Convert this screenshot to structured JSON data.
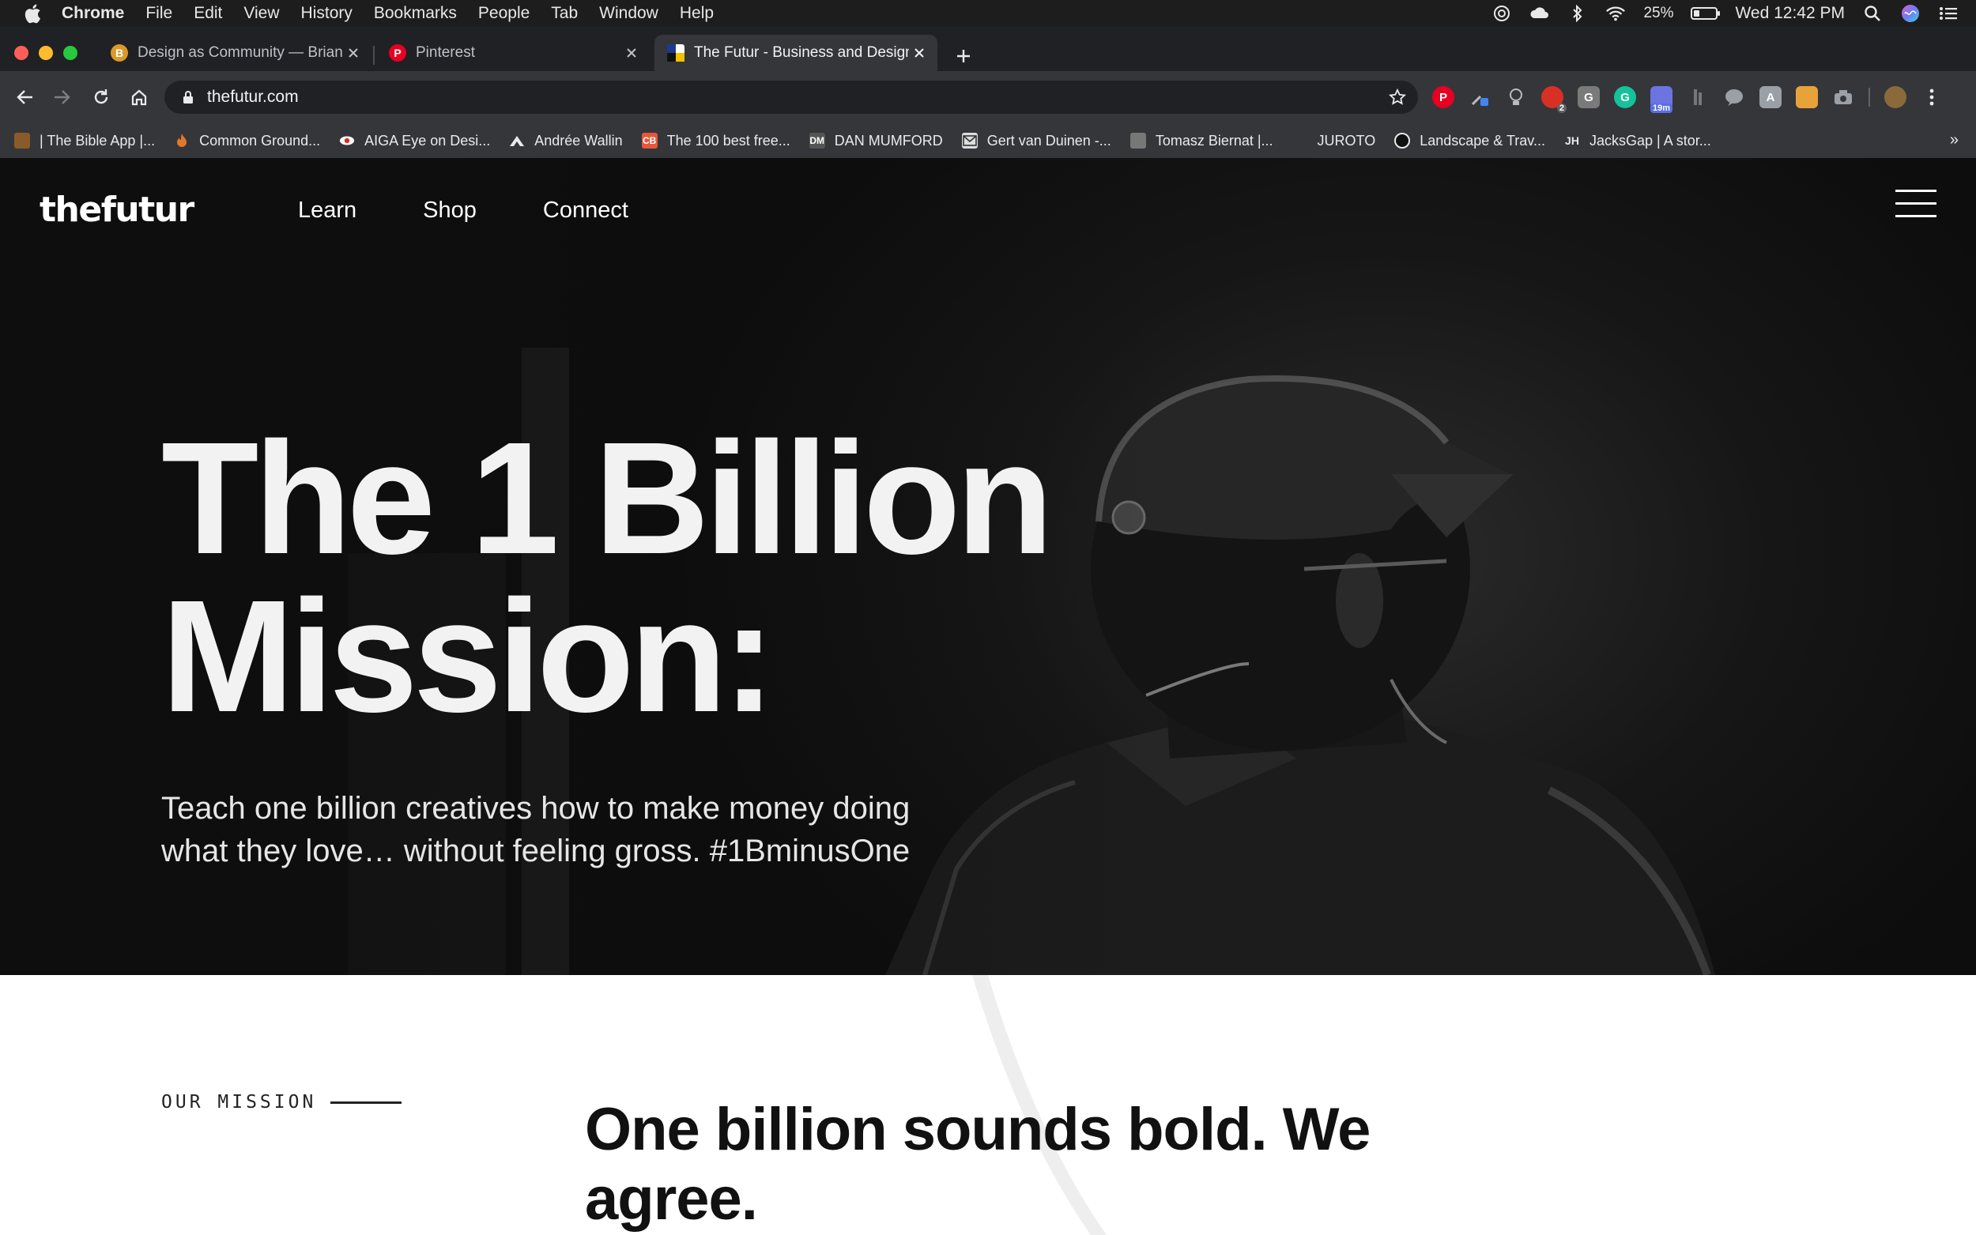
{
  "menubar": {
    "app_name": "Chrome",
    "menus": [
      "File",
      "Edit",
      "View",
      "History",
      "Bookmarks",
      "People",
      "Tab",
      "Window",
      "Help"
    ],
    "battery_pct": "25%",
    "battery_level": 0.25,
    "datetime": "Wed 12:42 PM"
  },
  "tabs": [
    {
      "title": "Design as Community — Brian",
      "favicon": "B",
      "favicon_color": "#d99a2b",
      "active": false
    },
    {
      "title": "Pinterest",
      "favicon": "P",
      "favicon_color": "#e60023",
      "active": false
    },
    {
      "title": "The Futur - Business and Design",
      "favicon": "F",
      "favicon_color": "#1a3a8f",
      "active": true
    }
  ],
  "toolbar": {
    "url": "thefutur.com",
    "extension_badges": [
      "2",
      "19m"
    ]
  },
  "bookmarks": [
    {
      "label": "| The Bible App |...",
      "icon_color": "#8b5a2b"
    },
    {
      "label": "Common Ground...",
      "icon_color": "#e0792a"
    },
    {
      "label": "AIGA Eye on Desi...",
      "icon_color": "#d62d20"
    },
    {
      "label": "Andrée Wallin",
      "icon_color": "#111111"
    },
    {
      "label": "The 100 best free...",
      "icon_color": "#e8563a"
    },
    {
      "label": "DAN MUMFORD",
      "icon_color": "#555555"
    },
    {
      "label": "Gert van Duinen -...",
      "icon_color": "#dddddd"
    },
    {
      "label": "Tomasz Biernat |...",
      "icon_color": "#777777"
    },
    {
      "label": "JUROTO",
      "icon_color": "#35363a"
    },
    {
      "label": "Landscape & Trav...",
      "icon_color": "#111111"
    },
    {
      "label": "JacksGap | A stor...",
      "icon_color": "#35363a"
    }
  ],
  "site": {
    "logo": "thefutur",
    "nav": [
      "Learn",
      "Shop",
      "Connect"
    ]
  },
  "hero": {
    "title": "The 1 Billion Mission:",
    "subtitle": "Teach one billion creatives how to make money doing what they love… without feeling gross. #1BminusOne"
  },
  "mission": {
    "label": "OUR MISSION",
    "heading": "One billion sounds bold. We agree."
  }
}
